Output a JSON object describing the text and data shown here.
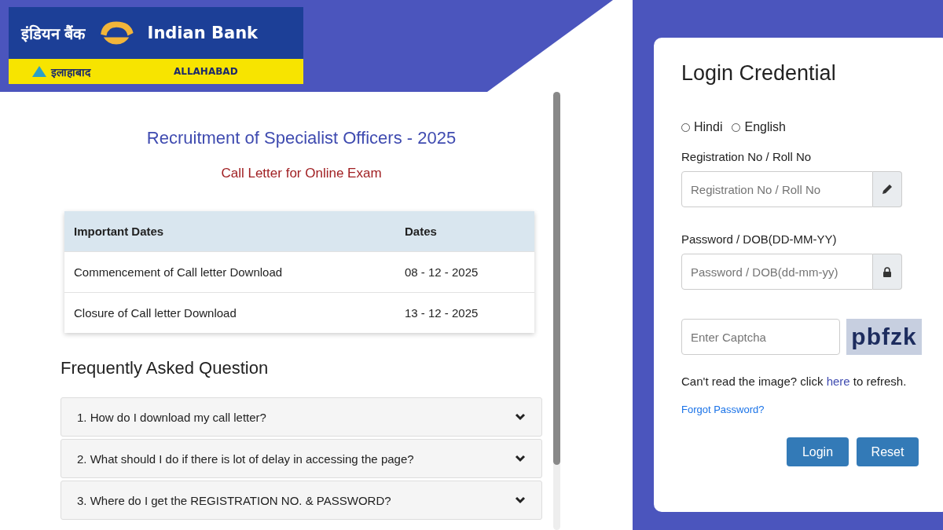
{
  "logo": {
    "hindi_name": "इंडियन बैंक",
    "english_name": "Indian Bank",
    "hindi_sub": "इलाहाबाद",
    "english_sub": "ALLAHABAD"
  },
  "main": {
    "title": "Recruitment of Specialist Officers - 2025",
    "subtitle": "Call Letter for Online Exam",
    "dates_table": {
      "columns": [
        "Important Dates",
        "Dates"
      ],
      "rows": [
        {
          "event": "Commencement of Call letter Download",
          "date": "08 - 12 - 2025"
        },
        {
          "event": "Closure of Call letter Download",
          "date": "13 - 12 - 2025"
        }
      ]
    },
    "faq_heading": "Frequently Asked Question",
    "faq": [
      {
        "question": "1. How do I download my call letter?",
        "expanded": false
      },
      {
        "question": "2. What should I do if there is lot of delay in accessing the page?",
        "expanded": false
      },
      {
        "question": "3. Where do I get the REGISTRATION NO. & PASSWORD?",
        "expanded": false
      }
    ]
  },
  "login": {
    "title": "Login Credential",
    "languages": [
      {
        "label": "Hindi",
        "selected": false
      },
      {
        "label": "English",
        "selected": false
      }
    ],
    "registration_label": "Registration No / Roll No",
    "registration_placeholder": "Registration No / Roll No",
    "password_label": "Password / DOB(DD-MM-YY)",
    "password_placeholder": "Password / DOB(dd-mm-yy)",
    "captcha_placeholder": "Enter Captcha",
    "captcha_text": "pbfzk",
    "refresh_before": "Can't read the image? click",
    "refresh_link": "here",
    "refresh_after": "to refresh.",
    "forgot": "Forgot Password?",
    "buttons": [
      "Login",
      "Reset"
    ]
  }
}
